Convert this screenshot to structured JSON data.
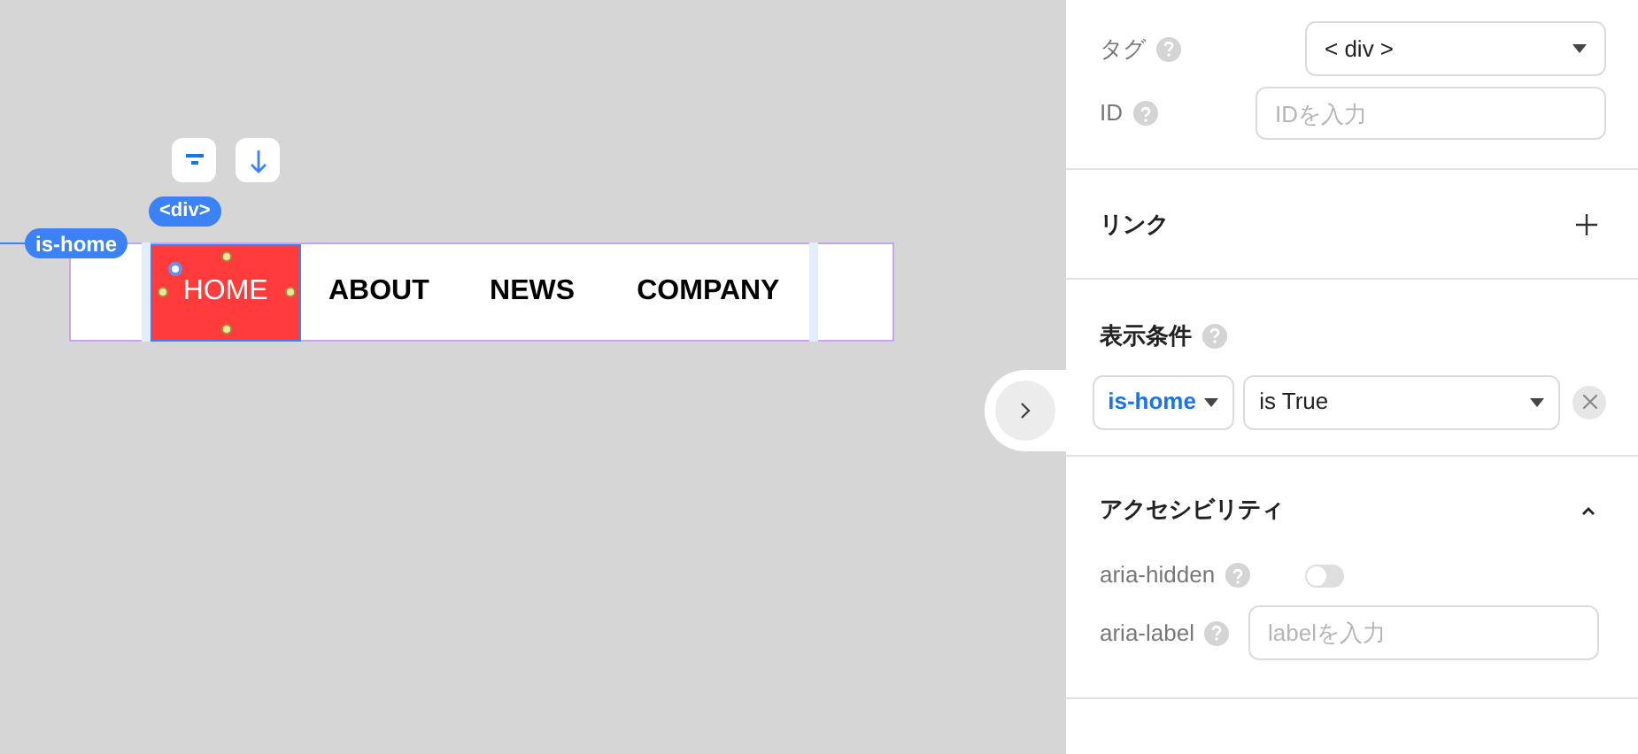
{
  "canvas": {
    "condition_badge": "is-home",
    "element_tag": "<div>",
    "nav_items": [
      {
        "label": "HOME",
        "selected": true
      },
      {
        "label": "ABOUT",
        "selected": false
      },
      {
        "label": "NEWS",
        "selected": false
      },
      {
        "label": "COMPANY",
        "selected": false
      }
    ]
  },
  "panel": {
    "tag": {
      "label": "タグ",
      "value": "< div >"
    },
    "id": {
      "label": "ID",
      "placeholder": "IDを入力"
    },
    "link": {
      "title": "リンク"
    },
    "condition": {
      "title": "表示条件",
      "variable": "is-home",
      "operator": "is True"
    },
    "accessibility": {
      "title": "アクセシビリティ",
      "expanded": true,
      "aria_hidden": {
        "label": "aria-hidden",
        "on": false
      },
      "aria_label": {
        "label": "aria-label",
        "placeholder": "labelを入力"
      }
    }
  }
}
